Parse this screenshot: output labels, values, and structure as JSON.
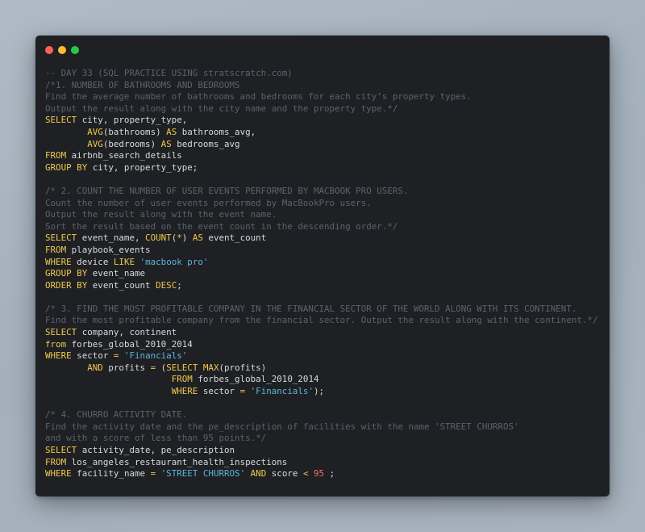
{
  "window": {
    "buttons": [
      "close",
      "minimize",
      "maximize"
    ],
    "colors": {
      "close": "#ff5f57",
      "minimize": "#febc2e",
      "maximize": "#28c840",
      "background": "#1e2024",
      "comment": "#5b636e",
      "keyword": "#f2c94c",
      "string": "#5fb4d8",
      "number": "#ff6b6b",
      "text": "#d6d9de"
    }
  },
  "code": {
    "lines": [
      [
        [
          "comment",
          "-- DAY 33 (SQL PRACTICE USING stratscratch.com)"
        ]
      ],
      [
        [
          "comment",
          "/*1. NUMBER OF BATHROOMS AND BEDROOMS"
        ]
      ],
      [
        [
          "comment",
          "Find the average number of bathrooms and bedrooms for each city’s property types."
        ]
      ],
      [
        [
          "comment",
          "Output the result along with the city name and the property type.*/"
        ]
      ],
      [
        [
          "keyword",
          "SELECT"
        ],
        [
          "plain",
          " city, property_type,"
        ]
      ],
      [
        [
          "plain",
          "        "
        ],
        [
          "func",
          "AVG"
        ],
        [
          "plain",
          "(bathrooms) "
        ],
        [
          "keyword",
          "AS"
        ],
        [
          "plain",
          " bathrooms_avg,"
        ]
      ],
      [
        [
          "plain",
          "        "
        ],
        [
          "func",
          "AVG"
        ],
        [
          "plain",
          "(bedrooms) "
        ],
        [
          "keyword",
          "AS"
        ],
        [
          "plain",
          " bedrooms_avg"
        ]
      ],
      [
        [
          "keyword",
          "FROM"
        ],
        [
          "plain",
          " airbnb_search_details"
        ]
      ],
      [
        [
          "keyword",
          "GROUP BY"
        ],
        [
          "plain",
          " city, property_type;"
        ]
      ],
      [
        [
          "plain",
          ""
        ]
      ],
      [
        [
          "comment",
          "/* 2. COUNT THE NUMBER OF USER EVENTS PERFORMED BY MACBOOK PRO USERS."
        ]
      ],
      [
        [
          "comment",
          "Count the number of user events performed by MacBookPro users."
        ]
      ],
      [
        [
          "comment",
          "Output the result along with the event name."
        ]
      ],
      [
        [
          "comment",
          "Sort the result based on the event count in the descending order.*/"
        ]
      ],
      [
        [
          "keyword",
          "SELECT"
        ],
        [
          "plain",
          " event_name, "
        ],
        [
          "func",
          "COUNT"
        ],
        [
          "plain",
          "("
        ],
        [
          "op",
          "*"
        ],
        [
          "plain",
          ") "
        ],
        [
          "keyword",
          "AS"
        ],
        [
          "plain",
          " event_count"
        ]
      ],
      [
        [
          "keyword",
          "FROM"
        ],
        [
          "plain",
          " playbook_events"
        ]
      ],
      [
        [
          "keyword",
          "WHERE"
        ],
        [
          "plain",
          " device "
        ],
        [
          "keyword",
          "LIKE"
        ],
        [
          "plain",
          " "
        ],
        [
          "string",
          "'macbook pro'"
        ]
      ],
      [
        [
          "keyword",
          "GROUP BY"
        ],
        [
          "plain",
          " event_name"
        ]
      ],
      [
        [
          "keyword",
          "ORDER BY"
        ],
        [
          "plain",
          " event_count "
        ],
        [
          "keyword",
          "DESC"
        ],
        [
          "plain",
          ";"
        ]
      ],
      [
        [
          "plain",
          ""
        ]
      ],
      [
        [
          "comment",
          "/* 3. FIND THE MOST PROFITABLE COMPANY IN THE FINANCIAL SECTOR OF THE WORLD ALONG WITH ITS CONTINENT."
        ]
      ],
      [
        [
          "comment",
          "Find the most profitable company from the financial sector. Output the result along with the continent.*/"
        ]
      ],
      [
        [
          "keyword",
          "SELECT"
        ],
        [
          "plain",
          " company, continent"
        ]
      ],
      [
        [
          "keyword",
          "from"
        ],
        [
          "plain",
          " forbes_global_2010_2014"
        ]
      ],
      [
        [
          "keyword",
          "WHERE"
        ],
        [
          "plain",
          " sector "
        ],
        [
          "op",
          "="
        ],
        [
          "plain",
          " "
        ],
        [
          "string",
          "'Financials'"
        ]
      ],
      [
        [
          "plain",
          "        "
        ],
        [
          "keyword",
          "AND"
        ],
        [
          "plain",
          " profits "
        ],
        [
          "op",
          "="
        ],
        [
          "plain",
          " ("
        ],
        [
          "keyword",
          "SELECT"
        ],
        [
          "plain",
          " "
        ],
        [
          "func",
          "MAX"
        ],
        [
          "plain",
          "(profits)"
        ]
      ],
      [
        [
          "plain",
          "                        "
        ],
        [
          "keyword",
          "FROM"
        ],
        [
          "plain",
          " forbes_global_2010_2014"
        ]
      ],
      [
        [
          "plain",
          "                        "
        ],
        [
          "keyword",
          "WHERE"
        ],
        [
          "plain",
          " sector "
        ],
        [
          "op",
          "="
        ],
        [
          "plain",
          " "
        ],
        [
          "string",
          "'Financials'"
        ],
        [
          "plain",
          ");"
        ]
      ],
      [
        [
          "plain",
          ""
        ]
      ],
      [
        [
          "comment",
          "/* 4. CHURRO ACTIVITY DATE."
        ]
      ],
      [
        [
          "comment",
          "Find the activity date and the pe_description of facilities with the name 'STREET CHURROS'"
        ]
      ],
      [
        [
          "comment",
          "and with a score of less than 95 points.*/"
        ]
      ],
      [
        [
          "keyword",
          "SELECT"
        ],
        [
          "plain",
          " activity_date, pe_description"
        ]
      ],
      [
        [
          "keyword",
          "FROM"
        ],
        [
          "plain",
          " los_angeles_restaurant_health_inspections"
        ]
      ],
      [
        [
          "keyword",
          "WHERE"
        ],
        [
          "plain",
          " facility_name "
        ],
        [
          "op",
          "="
        ],
        [
          "plain",
          " "
        ],
        [
          "string",
          "'STREET CHURROS'"
        ],
        [
          "plain",
          " "
        ],
        [
          "keyword",
          "AND"
        ],
        [
          "plain",
          " score "
        ],
        [
          "op",
          "<"
        ],
        [
          "plain",
          " "
        ],
        [
          "number",
          "95"
        ],
        [
          "plain",
          " ;"
        ]
      ]
    ]
  }
}
